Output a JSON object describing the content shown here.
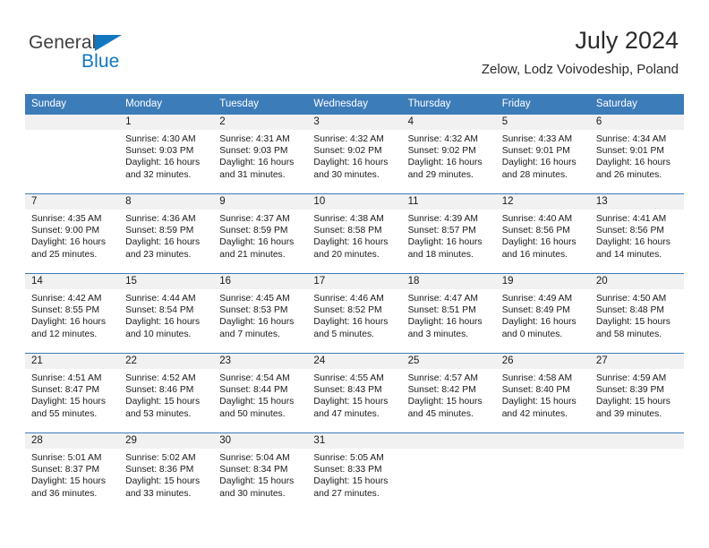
{
  "logo": {
    "word_top": "General",
    "word_bottom": "Blue",
    "triangle_color": "#1277bf",
    "text_color": "#3f3f3f"
  },
  "header": {
    "title": "July 2024",
    "subtitle": "Zelow, Lodz Voivodeship, Poland"
  },
  "theme": {
    "header_blue": "#3c7cb8",
    "daynum_band": "#f1f1f1",
    "text": "#1a1a1a"
  },
  "weekdays": [
    "Sunday",
    "Monday",
    "Tuesday",
    "Wednesday",
    "Thursday",
    "Friday",
    "Saturday"
  ],
  "labels": {
    "sunrise": "Sunrise:",
    "sunset": "Sunset:",
    "daylight": "Daylight:"
  },
  "weeks": [
    [
      {
        "day": "",
        "empty": true
      },
      {
        "day": "1",
        "sunrise": "Sunrise: 4:30 AM",
        "sunset": "Sunset: 9:03 PM",
        "daylight_1": "Daylight: 16 hours",
        "daylight_2": "and 32 minutes."
      },
      {
        "day": "2",
        "sunrise": "Sunrise: 4:31 AM",
        "sunset": "Sunset: 9:03 PM",
        "daylight_1": "Daylight: 16 hours",
        "daylight_2": "and 31 minutes."
      },
      {
        "day": "3",
        "sunrise": "Sunrise: 4:32 AM",
        "sunset": "Sunset: 9:02 PM",
        "daylight_1": "Daylight: 16 hours",
        "daylight_2": "and 30 minutes."
      },
      {
        "day": "4",
        "sunrise": "Sunrise: 4:32 AM",
        "sunset": "Sunset: 9:02 PM",
        "daylight_1": "Daylight: 16 hours",
        "daylight_2": "and 29 minutes."
      },
      {
        "day": "5",
        "sunrise": "Sunrise: 4:33 AM",
        "sunset": "Sunset: 9:01 PM",
        "daylight_1": "Daylight: 16 hours",
        "daylight_2": "and 28 minutes."
      },
      {
        "day": "6",
        "sunrise": "Sunrise: 4:34 AM",
        "sunset": "Sunset: 9:01 PM",
        "daylight_1": "Daylight: 16 hours",
        "daylight_2": "and 26 minutes."
      }
    ],
    [
      {
        "day": "7",
        "sunrise": "Sunrise: 4:35 AM",
        "sunset": "Sunset: 9:00 PM",
        "daylight_1": "Daylight: 16 hours",
        "daylight_2": "and 25 minutes."
      },
      {
        "day": "8",
        "sunrise": "Sunrise: 4:36 AM",
        "sunset": "Sunset: 8:59 PM",
        "daylight_1": "Daylight: 16 hours",
        "daylight_2": "and 23 minutes."
      },
      {
        "day": "9",
        "sunrise": "Sunrise: 4:37 AM",
        "sunset": "Sunset: 8:59 PM",
        "daylight_1": "Daylight: 16 hours",
        "daylight_2": "and 21 minutes."
      },
      {
        "day": "10",
        "sunrise": "Sunrise: 4:38 AM",
        "sunset": "Sunset: 8:58 PM",
        "daylight_1": "Daylight: 16 hours",
        "daylight_2": "and 20 minutes."
      },
      {
        "day": "11",
        "sunrise": "Sunrise: 4:39 AM",
        "sunset": "Sunset: 8:57 PM",
        "daylight_1": "Daylight: 16 hours",
        "daylight_2": "and 18 minutes."
      },
      {
        "day": "12",
        "sunrise": "Sunrise: 4:40 AM",
        "sunset": "Sunset: 8:56 PM",
        "daylight_1": "Daylight: 16 hours",
        "daylight_2": "and 16 minutes."
      },
      {
        "day": "13",
        "sunrise": "Sunrise: 4:41 AM",
        "sunset": "Sunset: 8:56 PM",
        "daylight_1": "Daylight: 16 hours",
        "daylight_2": "and 14 minutes."
      }
    ],
    [
      {
        "day": "14",
        "sunrise": "Sunrise: 4:42 AM",
        "sunset": "Sunset: 8:55 PM",
        "daylight_1": "Daylight: 16 hours",
        "daylight_2": "and 12 minutes."
      },
      {
        "day": "15",
        "sunrise": "Sunrise: 4:44 AM",
        "sunset": "Sunset: 8:54 PM",
        "daylight_1": "Daylight: 16 hours",
        "daylight_2": "and 10 minutes."
      },
      {
        "day": "16",
        "sunrise": "Sunrise: 4:45 AM",
        "sunset": "Sunset: 8:53 PM",
        "daylight_1": "Daylight: 16 hours",
        "daylight_2": "and 7 minutes."
      },
      {
        "day": "17",
        "sunrise": "Sunrise: 4:46 AM",
        "sunset": "Sunset: 8:52 PM",
        "daylight_1": "Daylight: 16 hours",
        "daylight_2": "and 5 minutes."
      },
      {
        "day": "18",
        "sunrise": "Sunrise: 4:47 AM",
        "sunset": "Sunset: 8:51 PM",
        "daylight_1": "Daylight: 16 hours",
        "daylight_2": "and 3 minutes."
      },
      {
        "day": "19",
        "sunrise": "Sunrise: 4:49 AM",
        "sunset": "Sunset: 8:49 PM",
        "daylight_1": "Daylight: 16 hours",
        "daylight_2": "and 0 minutes."
      },
      {
        "day": "20",
        "sunrise": "Sunrise: 4:50 AM",
        "sunset": "Sunset: 8:48 PM",
        "daylight_1": "Daylight: 15 hours",
        "daylight_2": "and 58 minutes."
      }
    ],
    [
      {
        "day": "21",
        "sunrise": "Sunrise: 4:51 AM",
        "sunset": "Sunset: 8:47 PM",
        "daylight_1": "Daylight: 15 hours",
        "daylight_2": "and 55 minutes."
      },
      {
        "day": "22",
        "sunrise": "Sunrise: 4:52 AM",
        "sunset": "Sunset: 8:46 PM",
        "daylight_1": "Daylight: 15 hours",
        "daylight_2": "and 53 minutes."
      },
      {
        "day": "23",
        "sunrise": "Sunrise: 4:54 AM",
        "sunset": "Sunset: 8:44 PM",
        "daylight_1": "Daylight: 15 hours",
        "daylight_2": "and 50 minutes."
      },
      {
        "day": "24",
        "sunrise": "Sunrise: 4:55 AM",
        "sunset": "Sunset: 8:43 PM",
        "daylight_1": "Daylight: 15 hours",
        "daylight_2": "and 47 minutes."
      },
      {
        "day": "25",
        "sunrise": "Sunrise: 4:57 AM",
        "sunset": "Sunset: 8:42 PM",
        "daylight_1": "Daylight: 15 hours",
        "daylight_2": "and 45 minutes."
      },
      {
        "day": "26",
        "sunrise": "Sunrise: 4:58 AM",
        "sunset": "Sunset: 8:40 PM",
        "daylight_1": "Daylight: 15 hours",
        "daylight_2": "and 42 minutes."
      },
      {
        "day": "27",
        "sunrise": "Sunrise: 4:59 AM",
        "sunset": "Sunset: 8:39 PM",
        "daylight_1": "Daylight: 15 hours",
        "daylight_2": "and 39 minutes."
      }
    ],
    [
      {
        "day": "28",
        "sunrise": "Sunrise: 5:01 AM",
        "sunset": "Sunset: 8:37 PM",
        "daylight_1": "Daylight: 15 hours",
        "daylight_2": "and 36 minutes."
      },
      {
        "day": "29",
        "sunrise": "Sunrise: 5:02 AM",
        "sunset": "Sunset: 8:36 PM",
        "daylight_1": "Daylight: 15 hours",
        "daylight_2": "and 33 minutes."
      },
      {
        "day": "30",
        "sunrise": "Sunrise: 5:04 AM",
        "sunset": "Sunset: 8:34 PM",
        "daylight_1": "Daylight: 15 hours",
        "daylight_2": "and 30 minutes."
      },
      {
        "day": "31",
        "sunrise": "Sunrise: 5:05 AM",
        "sunset": "Sunset: 8:33 PM",
        "daylight_1": "Daylight: 15 hours",
        "daylight_2": "and 27 minutes."
      },
      {
        "day": "",
        "empty": true
      },
      {
        "day": "",
        "empty": true
      },
      {
        "day": "",
        "empty": true
      }
    ]
  ]
}
